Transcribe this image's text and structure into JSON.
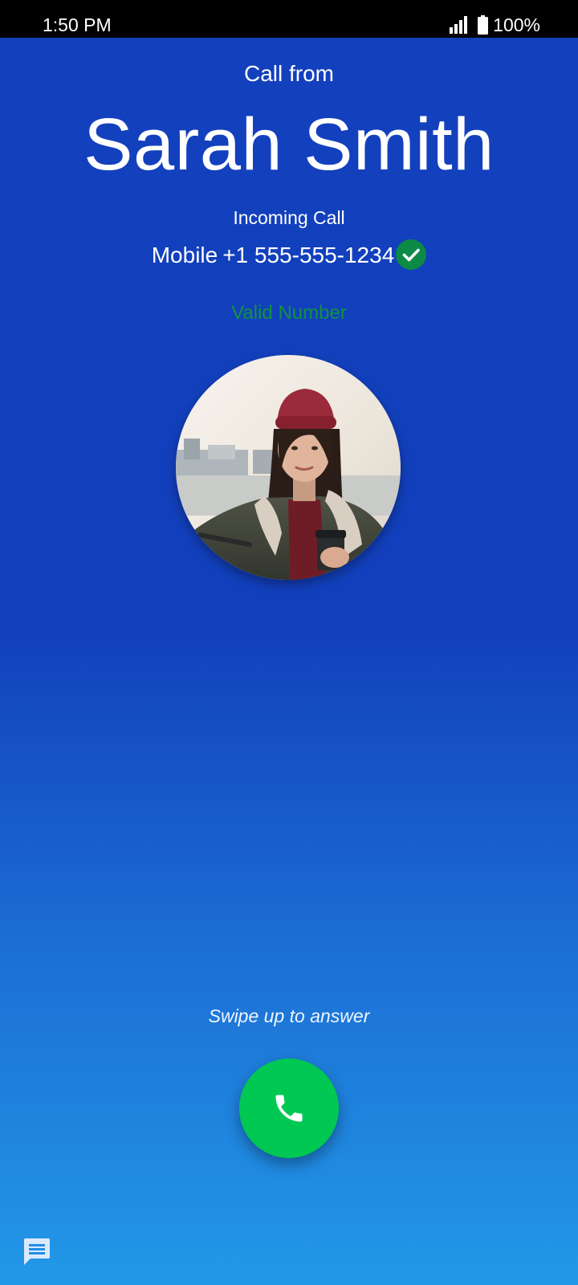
{
  "status_bar": {
    "time": "1:50 PM",
    "battery_percent": "100%",
    "icons": [
      "signal-icon",
      "battery-icon"
    ]
  },
  "call": {
    "header": "Call from",
    "caller_name": "Sarah Smith",
    "state": "Incoming Call",
    "number_label": "Mobile",
    "number": "+1 555-555-1234",
    "verification": "Valid Number",
    "verified_icon": "check-circle-icon"
  },
  "contact_photo": {
    "icon": "contact-photo"
  },
  "answer": {
    "hint": "Swipe up to answer",
    "icon": "phone-icon"
  },
  "message": {
    "icon": "message-icon"
  },
  "colors": {
    "background_top": "#1340bd",
    "background_bottom": "#2298e8",
    "answer_green": "#00c853",
    "verified_green": "#0d8a45",
    "valid_text_green": "#12923e"
  }
}
